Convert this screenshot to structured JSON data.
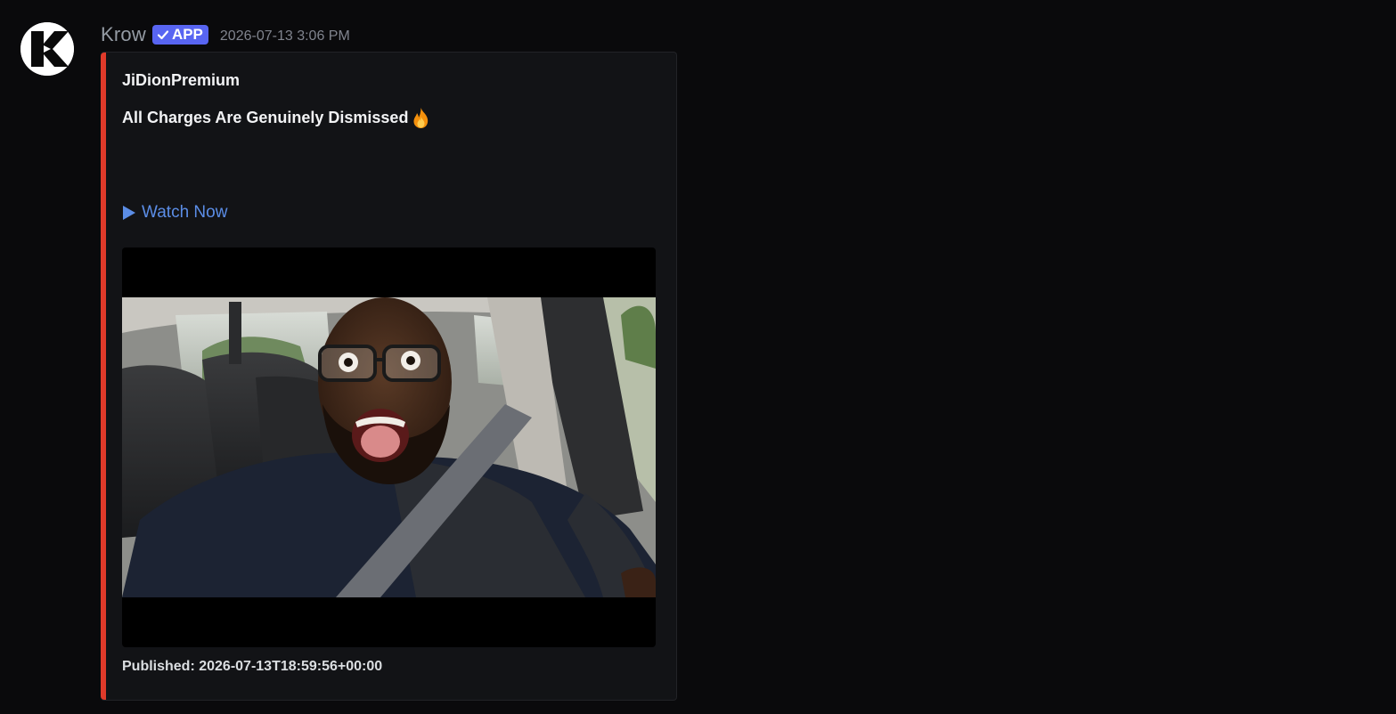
{
  "message": {
    "author": "Krow",
    "badge": "APP",
    "timestamp": "2026-07-13 3:06 PM",
    "avatar_icon": "k-logo-icon"
  },
  "embed": {
    "accent_color": "#e03a2a",
    "author_name": "JiDionPremium",
    "title": "All Charges Are Genuinely Dismissed",
    "title_emoji": "fire-icon",
    "link_text": "Watch Now",
    "link_icon": "play-icon",
    "image_alt": "Thumbnail: man in glasses with seatbelt, shocked expression inside a car",
    "footer": "Published: 2026-07-13T18:59:56+00:00"
  }
}
